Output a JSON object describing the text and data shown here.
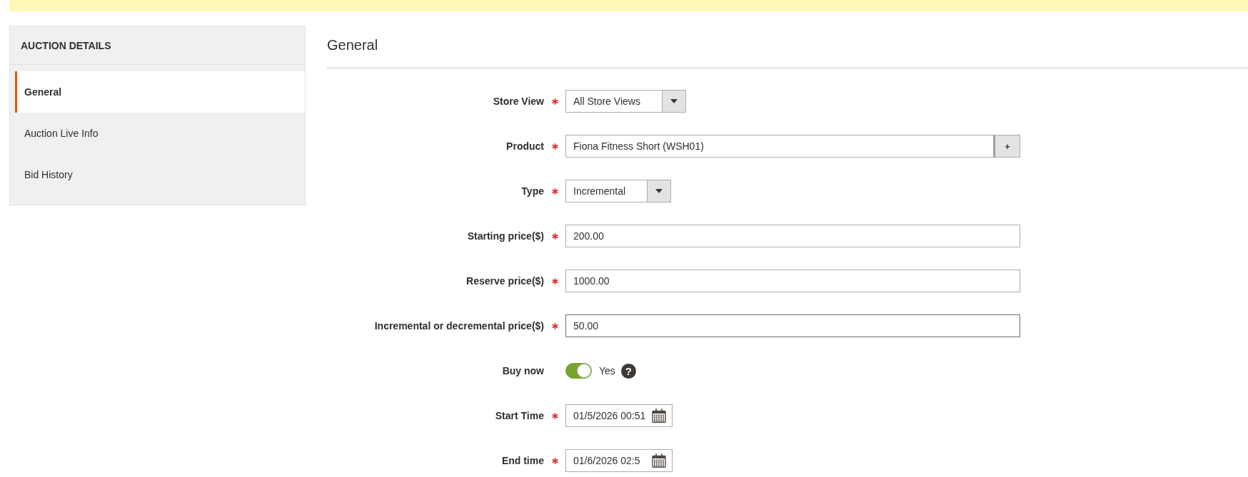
{
  "sidebar": {
    "title": "AUCTION DETAILS",
    "items": [
      {
        "label": "General",
        "selected": true
      },
      {
        "label": "Auction Live Info",
        "selected": false
      },
      {
        "label": "Bid History",
        "selected": false
      }
    ]
  },
  "section": {
    "title": "General"
  },
  "fields": [
    {
      "kind": "select",
      "label": "Store View",
      "required": true,
      "focused": false,
      "value": "All Store Views"
    },
    {
      "kind": "lookup",
      "label": "Product",
      "required": true,
      "focused": false,
      "value": "Fiona Fitness Short (WSH01)",
      "button": "+"
    },
    {
      "kind": "select",
      "label": "Type",
      "required": true,
      "focused": false,
      "value": "Incremental"
    },
    {
      "kind": "text",
      "label": "Starting price($)",
      "required": true,
      "focused": false,
      "value": "200.00"
    },
    {
      "kind": "text",
      "label": "Reserve price($)",
      "required": true,
      "focused": false,
      "value": "1000.00"
    },
    {
      "kind": "text",
      "label": "Incremental or decremental price($)",
      "required": true,
      "focused": true,
      "value": "50.00"
    },
    {
      "kind": "toggle",
      "label": "Buy now",
      "required": false,
      "focused": false,
      "on": true,
      "value": "Yes",
      "help": "?"
    },
    {
      "kind": "date",
      "label": "Start Time",
      "required": true,
      "focused": false,
      "value": "01/5/2026 00:51"
    },
    {
      "kind": "date",
      "label": "End time",
      "required": true,
      "focused": false,
      "value": "01/6/2026 02:5"
    }
  ]
}
